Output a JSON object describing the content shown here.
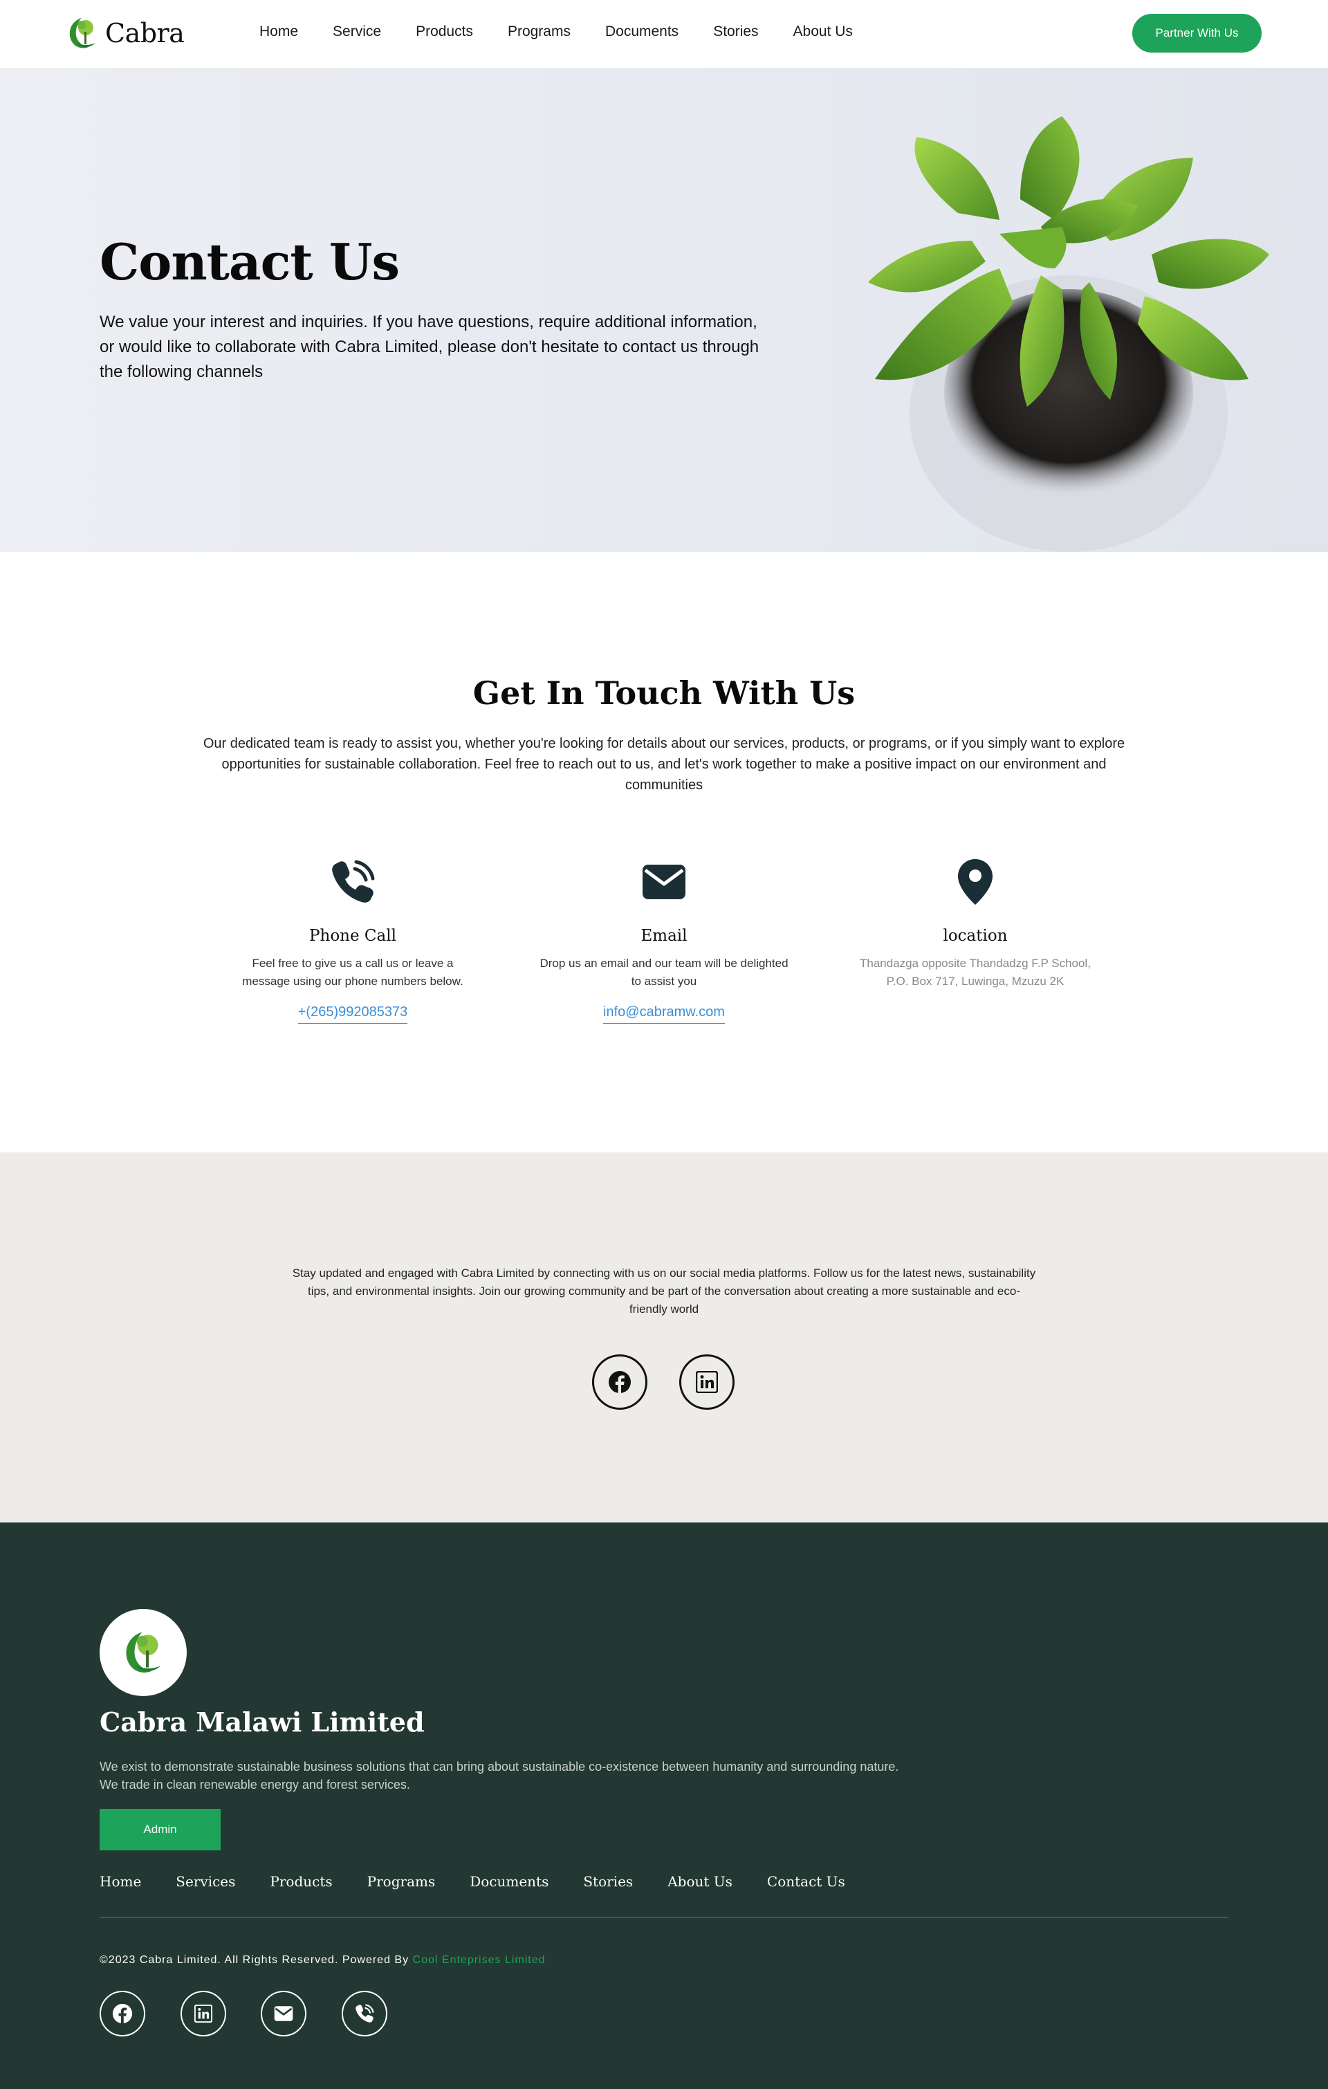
{
  "nav": {
    "brand": "Cabra",
    "links": [
      "Home",
      "Service",
      "Products",
      "Programs",
      "Documents",
      "Stories",
      "About Us"
    ],
    "cta": "Partner With Us"
  },
  "hero": {
    "title": "Contact Us",
    "text": "We value your interest and inquiries. If you have questions, require additional information, or would like to collaborate with Cabra Limited, please don't hesitate to contact us through the following channels"
  },
  "touch": {
    "title": "Get In Touch With Us",
    "text": "Our dedicated team is ready to assist you, whether you're looking for details about our services, products, or programs, or if you simply want to explore opportunities for sustainable collaboration. Feel free to reach out to us, and let's work together to make a positive impact on our environment and communities",
    "cards": [
      {
        "icon": "phone-icon",
        "title": "Phone Call",
        "text": "Feel free to give us a call us or leave a message using our phone numbers below.",
        "link": "+(265)992085373"
      },
      {
        "icon": "envelope-icon",
        "title": "Email",
        "text": "Drop us an email and our team will be delighted to assist you",
        "link": "info@cabramw.com"
      },
      {
        "icon": "location-pin-icon",
        "title": "location",
        "text": "Thandazga opposite Thandadzg F.P School, P.O. Box 717, Luwinga, Mzuzu 2K"
      }
    ]
  },
  "social": {
    "text": "Stay updated and engaged with Cabra Limited by connecting with us on our social media platforms. Follow us for the latest news, sustainability tips, and environmental insights. Join our growing community and be part of the conversation about creating a more sustainable and eco-friendly world",
    "icons": [
      "facebook-icon",
      "linkedin-icon"
    ]
  },
  "footer": {
    "company": "Cabra Malawi Limited",
    "text": "We exist to demonstrate sustainable business solutions that can bring about sustainable co-existence between humanity and surrounding nature. We trade in clean renewable energy and forest services.",
    "admin": "Admin",
    "links": [
      "Home",
      "Services",
      "Products",
      "Programs",
      "Documents",
      "Stories",
      "About Us",
      "Contact Us"
    ],
    "copyright": "©2023 Cabra Limited. All Rights Reserved. Powered By",
    "powered_by": "Cool Enteprises Limited",
    "icons": [
      "facebook-icon",
      "linkedin-icon",
      "envelope-icon",
      "phone-icon"
    ]
  },
  "colors": {
    "accent": "#1ea35b",
    "footer_bg": "#233832",
    "social_bg": "#eeece8",
    "icon_dark": "#1c2e35",
    "link": "#3a8fd8"
  }
}
